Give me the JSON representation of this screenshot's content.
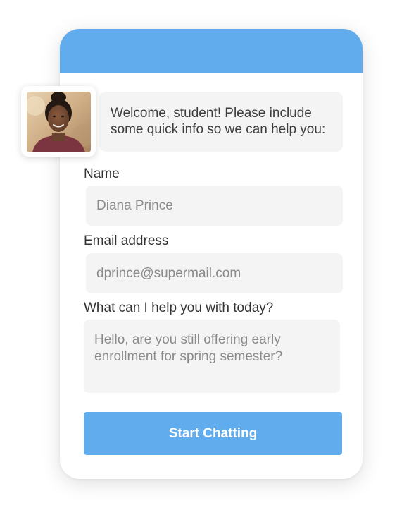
{
  "widget": {
    "welcome_message": "Welcome, student! Please include some quick info so we can help you:",
    "avatar_icon": "person-photo-icon"
  },
  "form": {
    "name_label": "Name",
    "name_value": "Diana Prince",
    "email_label": "Email address",
    "email_value": "dprince@supermail.com",
    "message_label": "What can I help you with today?",
    "message_value": "Hello, are you still offering early enrollment for spring semester?",
    "submit_label": "Start Chatting"
  },
  "colors": {
    "accent": "#60acec",
    "field_background": "#f4f4f4",
    "label_text": "#333333",
    "value_text": "#8a8a8a"
  }
}
